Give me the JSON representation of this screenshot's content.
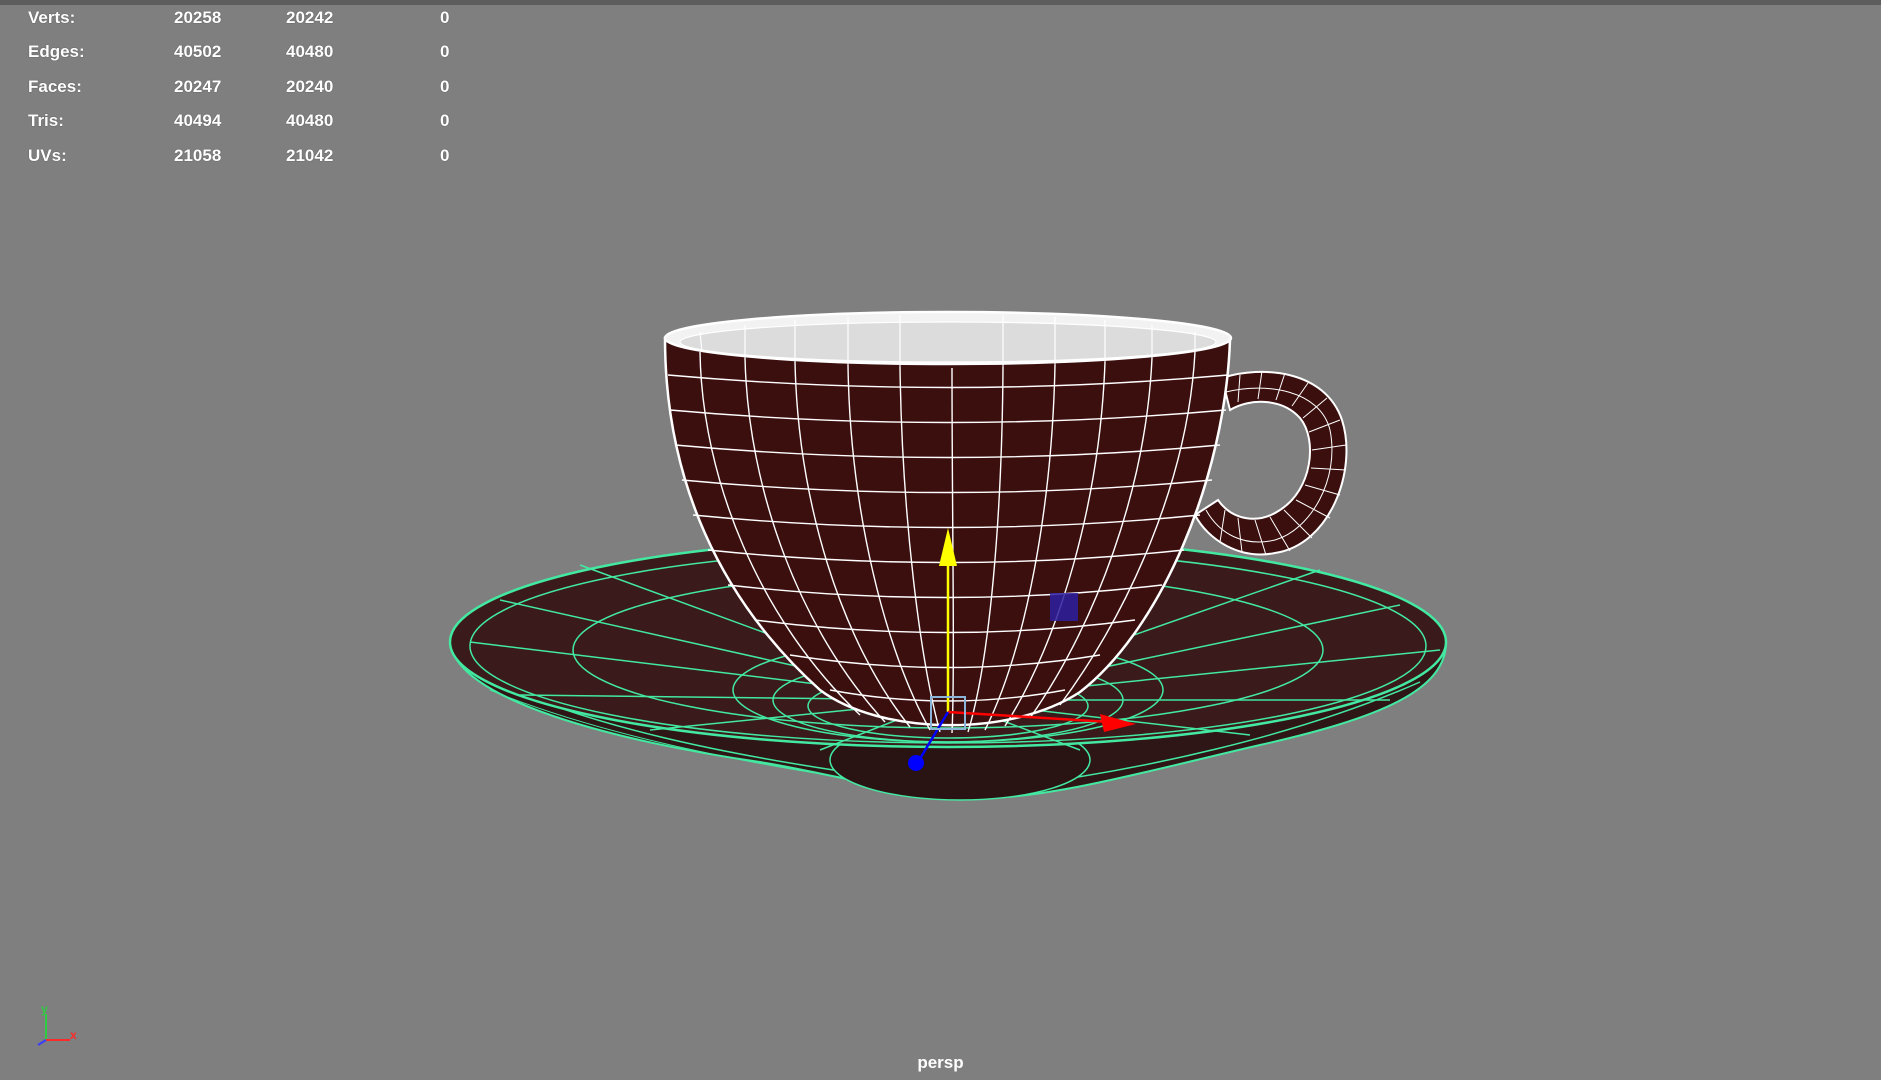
{
  "heads_up_display": {
    "rows": [
      {
        "label": "Verts:",
        "values": [
          "20258",
          "20242",
          "0"
        ]
      },
      {
        "label": "Edges:",
        "values": [
          "40502",
          "40480",
          "0"
        ]
      },
      {
        "label": "Faces:",
        "values": [
          "20247",
          "20240",
          "0"
        ]
      },
      {
        "label": "Tris:",
        "values": [
          "40494",
          "40480",
          "0"
        ]
      },
      {
        "label": "UVs:",
        "values": [
          "21058",
          "21042",
          "0"
        ]
      }
    ]
  },
  "viewport": {
    "camera_label": "persp",
    "background_color": "#7f7f7f"
  },
  "axis_indicator": {
    "y_label": "y",
    "x_label": "x"
  },
  "colors": {
    "cup_fill": "#3c0f0f",
    "saucer_fill": "#3a1a1a",
    "wire_unselected": "#ffffff",
    "wire_selected": "#43e8a1",
    "move_y": "#ffff00",
    "move_x": "#ff0000",
    "move_z": "#0000ff"
  }
}
